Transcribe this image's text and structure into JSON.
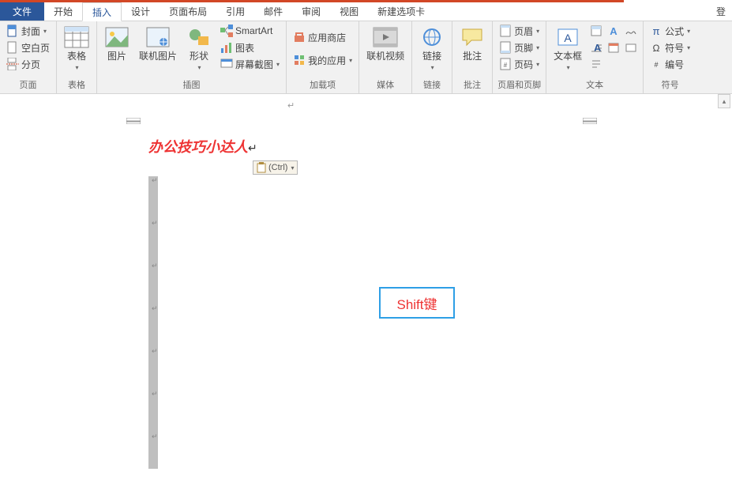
{
  "tabs": {
    "file": "文件",
    "home": "开始",
    "insert": "插入",
    "design": "设计",
    "layout": "页面布局",
    "references": "引用",
    "mail": "邮件",
    "review": "审阅",
    "view": "视图",
    "newtab": "新建选项卡"
  },
  "login": "登",
  "ribbon": {
    "pages": {
      "cover": "封面",
      "blank": "空白页",
      "break": "分页",
      "label": "页面"
    },
    "tables": {
      "table": "表格",
      "label": "表格"
    },
    "illus": {
      "picture": "图片",
      "online_pic": "联机图片",
      "shapes": "形状",
      "smartart": "SmartArt",
      "chart": "图表",
      "screenshot": "屏幕截图",
      "label": "插图"
    },
    "addins": {
      "store": "应用商店",
      "myapps": "我的应用",
      "label": "加载项"
    },
    "media": {
      "video": "联机视频",
      "label": "媒体"
    },
    "links": {
      "link": "链接",
      "label": "链接"
    },
    "comments": {
      "comment": "批注",
      "label": "批注"
    },
    "hf": {
      "header": "页眉",
      "footer": "页脚",
      "pagenum": "页码",
      "label": "页眉和页脚"
    },
    "text": {
      "textbox": "文本框",
      "label": "文本"
    },
    "symbols": {
      "equation": "公式",
      "symbol": "符号",
      "number": "编号",
      "label": "符号"
    }
  },
  "doc": {
    "title": "办公技巧小达人",
    "paste_tag": "(Ctrl)",
    "highlight": "Shift键"
  }
}
